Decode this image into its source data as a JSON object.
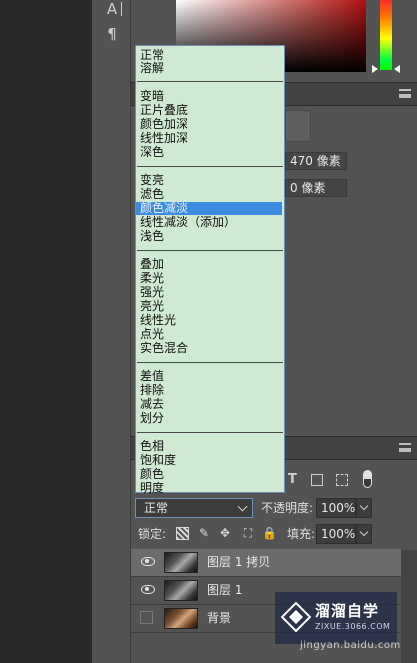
{
  "tools": {
    "type_tool_glyph": "A",
    "paragraph_glyph": "¶"
  },
  "properties": {
    "width_value": "470 像素",
    "offset_value": "0 像素"
  },
  "blend_modes": {
    "groups": [
      [
        "正常",
        "溶解"
      ],
      [
        "变暗",
        "正片叠底",
        "颜色加深",
        "线性加深",
        "深色"
      ],
      [
        "变亮",
        "滤色",
        "颜色减淡",
        "线性减淡（添加）",
        "浅色"
      ],
      [
        "叠加",
        "柔光",
        "强光",
        "亮光",
        "线性光",
        "点光",
        "实色混合"
      ],
      [
        "差值",
        "排除",
        "减去",
        "划分"
      ],
      [
        "色相",
        "饱和度",
        "颜色",
        "明度"
      ]
    ],
    "highlighted": "颜色减淡"
  },
  "layers": {
    "blend_value": "正常",
    "opacity_label": "不透明度:",
    "opacity_value": "100%",
    "lock_label": "锁定:",
    "fill_label": "填充:",
    "fill_value": "100%",
    "items": [
      {
        "name": "图层 1 拷贝",
        "visible": true,
        "active": true
      },
      {
        "name": "图层 1",
        "visible": true,
        "active": false
      },
      {
        "name": "背景",
        "visible": false,
        "active": false
      }
    ]
  },
  "watermark": {
    "title": "溜溜自学",
    "subtitle": "ZIXUE.3066.COM",
    "url": "jingyan.baidu.com"
  }
}
